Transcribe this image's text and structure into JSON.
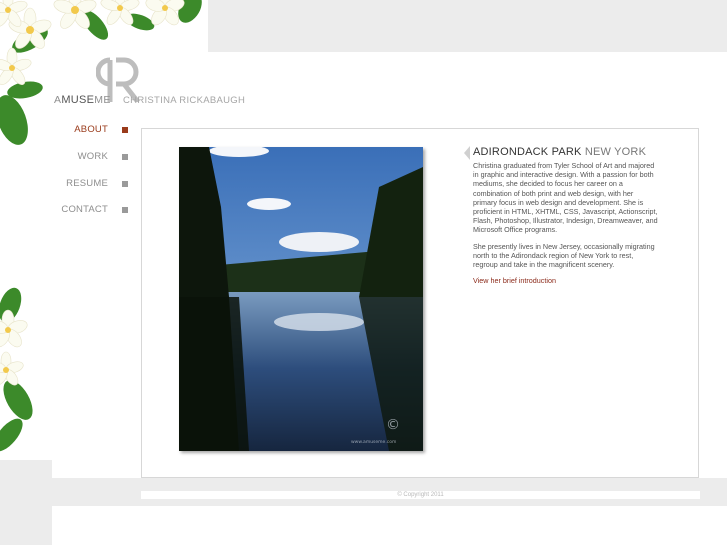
{
  "logo": {
    "monogram": "CR",
    "amuse_prefix": "A",
    "amuse_bold": "MUSE",
    "amuse_suffix": "ME",
    "name": "CHRISTINA RICKABAUGH"
  },
  "nav": {
    "items": [
      {
        "label": "ABOUT",
        "active": true
      },
      {
        "label": "WORK",
        "active": false
      },
      {
        "label": "RESUME",
        "active": false
      },
      {
        "label": "CONTACT",
        "active": false
      }
    ]
  },
  "content": {
    "heading_bold": "ADIRONDACK PARK",
    "heading_light": "NEW YORK",
    "paragraph1": "Christina graduated from Tyler School of Art and majored in graphic and interactive design. With a passion for both mediums, she decided to focus her career on a combination of both print and web design, with her primary focus in web design and development. She is proficient in HTML, XHTML, CSS, Javascript, Actionscript, Flash, Photoshop, Illustrator, Indesign, Dreamweaver, and Microsoft Office programs.",
    "paragraph2": "She presently lives in New Jersey, occasionally migrating north to the Adirondack region of New York to rest, regroup and take in the magnificent scenery.",
    "link": "View her brief introduction"
  },
  "photo": {
    "watermark_symbol": "©",
    "watermark_text": "www.amuseme.com"
  },
  "footer": {
    "copyright": "© Copyright 2011"
  },
  "colors": {
    "accent": "#9a3b1b",
    "link": "#8b2a1a",
    "gray_band": "#ececec"
  }
}
